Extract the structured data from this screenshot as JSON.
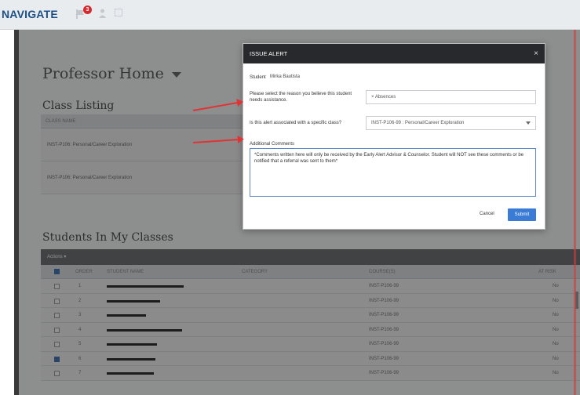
{
  "nav": {
    "brand": "NAVIGATE",
    "badge_count": "3"
  },
  "page": {
    "title": "Professor Home",
    "class_listing": {
      "title": "Class Listing",
      "header": "CLASS NAME",
      "rows": [
        "INST-P106: Personal/Career Exploration",
        "INST-P106: Personal/Career Exploration"
      ]
    },
    "students": {
      "title": "Students In My Classes",
      "actions_label": "Actions ▾",
      "columns": [
        "ORDER",
        "STUDENT NAME",
        "CATEGORY",
        "COURSE(S)",
        "AT RISK"
      ],
      "rows": [
        {
          "order": "1",
          "course": "INST-P106-99",
          "at_risk": "No",
          "checked": false
        },
        {
          "order": "2",
          "course": "INST-P106-99",
          "at_risk": "No",
          "checked": false
        },
        {
          "order": "3",
          "course": "INST-P106-99",
          "at_risk": "No",
          "checked": false
        },
        {
          "order": "4",
          "course": "INST-P106-99",
          "at_risk": "No",
          "checked": false
        },
        {
          "order": "5",
          "course": "INST-P106-99",
          "at_risk": "No",
          "checked": false
        },
        {
          "order": "6",
          "course": "INST-P106-99",
          "at_risk": "No",
          "checked": true
        },
        {
          "order": "7",
          "course": "INST-P106-99",
          "at_risk": "No",
          "checked": false
        }
      ]
    }
  },
  "modal": {
    "title": "ISSUE ALERT",
    "close_label": "×",
    "student_label": "Student",
    "student_name": "Mirka Bautista",
    "reason_label": "Please select the reason you believe this student needs assistance.",
    "reason_value": "× Absences",
    "class_label": "Is this alert associated with a specific class?",
    "class_value": "INST-P106-99 : Personal/Career Exploration",
    "comments_label": "Additional Comments",
    "comments_text": "*Comments written here will only be received by the Early Alert Advisor & Counselor. Student will NOT see these comments or be notified that a referral was sent to them*",
    "cancel_label": "Cancel",
    "submit_label": "Submit"
  },
  "colors": {
    "accent": "#3a7bd5",
    "arrow": "#e23232",
    "modal_header": "#27292c",
    "brand": "#1d4f86"
  }
}
